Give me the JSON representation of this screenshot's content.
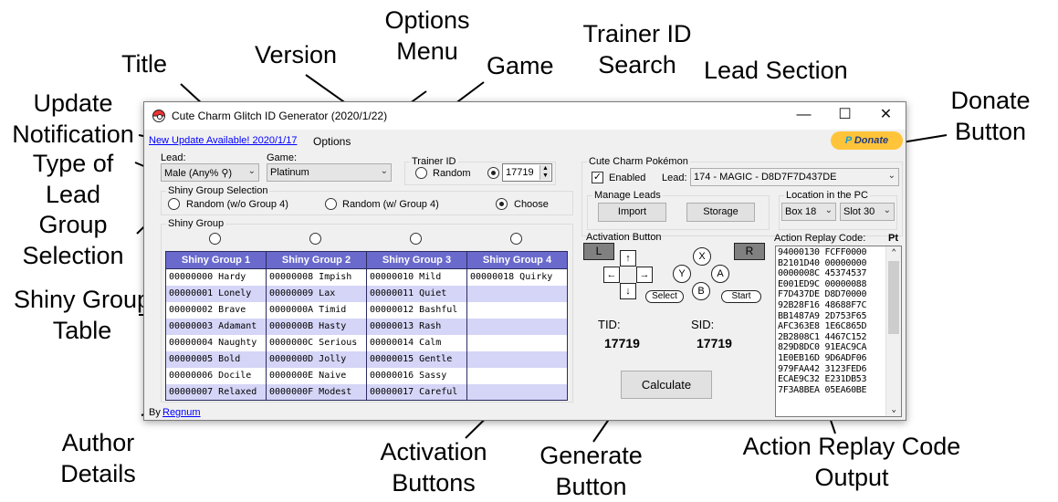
{
  "callouts": {
    "options_menu_1": "Options",
    "options_menu_2": "Menu",
    "trainer_id_1": "Trainer ID",
    "trainer_id_2": "Search",
    "title": "Title",
    "version": "Version",
    "game": "Game",
    "lead_section": "Lead Section",
    "update_1": "Update",
    "update_2": "Notification",
    "donate_1": "Donate",
    "donate_2": "Button",
    "type_1": "Type of",
    "type_2": "Lead",
    "group_sel_1": "Group",
    "group_sel_2": "Selection",
    "shiny_table_1": "Shiny Group",
    "shiny_table_2": "Table",
    "author_1": "Author",
    "author_2": "Details",
    "activation_1": "Activation",
    "activation_2": "Buttons",
    "generate_1": "Generate",
    "generate_2": "Button",
    "ar_output_1": "Action Replay Code",
    "ar_output_2": "Output"
  },
  "window": {
    "title": "Cute Charm Glitch ID Generator (2020/1/22)",
    "minimize": "—",
    "maximize": "☐",
    "close": "✕"
  },
  "menu": {
    "update_link": "New Update Available! 2020/1/17",
    "options": "Options"
  },
  "donate": {
    "icon": "P",
    "label": "Donate"
  },
  "lead": {
    "label": "Lead:",
    "value": "Male (Any% ⚲)"
  },
  "game": {
    "label": "Game:",
    "value": "Platinum"
  },
  "trainer_id": {
    "title": "Trainer ID",
    "random": "Random",
    "value": "17719"
  },
  "shiny_group_selection": {
    "title": "Shiny Group Selection",
    "option1": "Random (w/o Group 4)",
    "option2": "Random (w/ Group 4)",
    "option3": "Choose"
  },
  "shiny_group": {
    "title": "Shiny Group",
    "headers": [
      "Shiny Group 1",
      "Shiny Group 2",
      "Shiny Group 3",
      "Shiny Group 4"
    ],
    "rows": [
      [
        "00000000 Hardy",
        "00000008 Impish",
        "00000010 Mild",
        "00000018 Quirky"
      ],
      [
        "00000001 Lonely",
        "00000009 Lax",
        "00000011 Quiet",
        ""
      ],
      [
        "00000002 Brave",
        "0000000A Timid",
        "00000012 Bashful",
        ""
      ],
      [
        "00000003 Adamant",
        "0000000B Hasty",
        "00000013 Rash",
        ""
      ],
      [
        "00000004 Naughty",
        "0000000C Serious",
        "00000014 Calm",
        ""
      ],
      [
        "00000005 Bold",
        "0000000D Jolly",
        "00000015 Gentle",
        ""
      ],
      [
        "00000006 Docile",
        "0000000E Naive",
        "00000016 Sassy",
        ""
      ],
      [
        "00000007 Relaxed",
        "0000000F Modest",
        "00000017 Careful",
        ""
      ]
    ]
  },
  "cute_charm": {
    "title": "Cute Charm Pokémon",
    "enabled": "Enabled",
    "check": "✓",
    "lead_label": "Lead:",
    "lead_value": "174 - MAGIC - D8D7F7D437DE"
  },
  "manage_leads": {
    "title": "Manage Leads",
    "import": "Import",
    "storage": "Storage"
  },
  "location": {
    "title": "Location in the PC",
    "box": "Box 18",
    "slot": "Slot 30"
  },
  "activation": {
    "title": "Activation Button",
    "L": "L",
    "R": "R",
    "up": "↑",
    "left": "←",
    "right": "→",
    "down": "↓",
    "X": "X",
    "Y": "Y",
    "A": "A",
    "B": "B",
    "select": "Select",
    "start": "Start"
  },
  "ids": {
    "tid_label": "TID:",
    "sid_label": "SID:",
    "tid": "17719",
    "sid": "17719"
  },
  "calculate": "Calculate",
  "action_replay": {
    "label": "Action Replay Code:",
    "game_tag": "Pt",
    "lines": [
      "94000130 FCFF0000",
      "B2101D40 00000000",
      "0000008C 45374537",
      "E001ED9C 00000088",
      "F7D437DE D8D70000",
      "92B28F16 48688F7C",
      "BB1487A9 2D753F65",
      "AFC363E8 1E6C865D",
      "2B2808C1 4467C152",
      "829D8DC0 91EAC9CA",
      "1E0EB16D 9D6ADF06",
      "979FAA42 3123FED6",
      "ECAE9C32 E231DB53",
      "7F3A8BEA 05EA60BE"
    ]
  },
  "author": {
    "by": "By",
    "name": "Regnum"
  },
  "colors": {
    "table_header": "#6a6acd",
    "table_alt_row": "#d5d5f7",
    "donate_bg": "#ffc439"
  }
}
